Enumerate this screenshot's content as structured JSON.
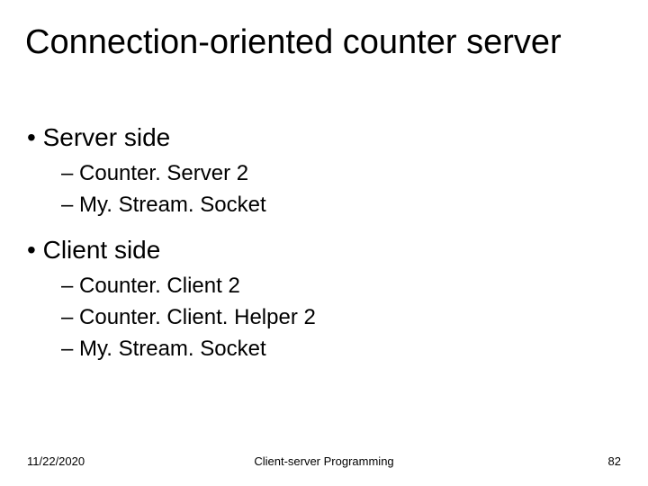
{
  "title": "Connection-oriented counter server",
  "bullets": {
    "server_side": {
      "label": "Server side",
      "items": [
        "Counter. Server 2",
        "My. Stream. Socket"
      ]
    },
    "client_side": {
      "label": "Client side",
      "items": [
        "Counter. Client 2",
        "Counter. Client. Helper 2",
        "My. Stream. Socket"
      ]
    }
  },
  "footer": {
    "date": "11/22/2020",
    "center": "Client-server Programming",
    "page": "82"
  },
  "bullet1_prefix": "• ",
  "bullet2_prefix": "– "
}
